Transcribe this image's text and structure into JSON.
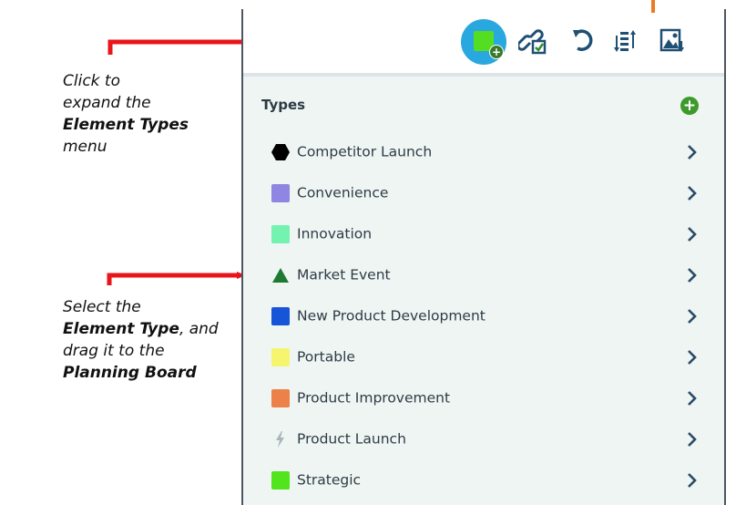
{
  "annotations": {
    "expand": {
      "line1": "Click to",
      "line2": "expand the",
      "bold": "Element Types",
      "line4": "menu"
    },
    "select": {
      "line1": "Select the",
      "bold1": "Element Type",
      "after1": ", and",
      "line3": "drag it to the",
      "bold2": "Planning Board"
    }
  },
  "toolbar": {
    "buttons": [
      {
        "icon": "add-element-type-icon"
      },
      {
        "icon": "link-check-icon"
      },
      {
        "icon": "refresh-icon"
      },
      {
        "icon": "sort-icon"
      },
      {
        "icon": "image-export-icon"
      }
    ]
  },
  "types": {
    "header": "Types",
    "items": [
      {
        "label": "Competitor Launch",
        "icon": "hexagon",
        "color": "#000000"
      },
      {
        "label": "Convenience",
        "icon": "square",
        "color": "#8f85e3"
      },
      {
        "label": "Innovation",
        "icon": "square",
        "color": "#74f2b0"
      },
      {
        "label": "Market Event",
        "icon": "triangle",
        "color": "#1e7a32"
      },
      {
        "label": "New Product Development",
        "icon": "square",
        "color": "#1755d8"
      },
      {
        "label": "Portable",
        "icon": "square",
        "color": "#f6f56e"
      },
      {
        "label": "Product Improvement",
        "icon": "square",
        "color": "#ec8149"
      },
      {
        "label": "Product Launch",
        "icon": "lightning",
        "color": "#aab4ba"
      },
      {
        "label": "Strategic",
        "icon": "square",
        "color": "#52e41c"
      }
    ]
  },
  "colors": {
    "accent_blue": "#29a8e0",
    "arrow_red": "#e8161b",
    "chevron": "#2a4a66",
    "panel_bg": "#eef5f3"
  }
}
